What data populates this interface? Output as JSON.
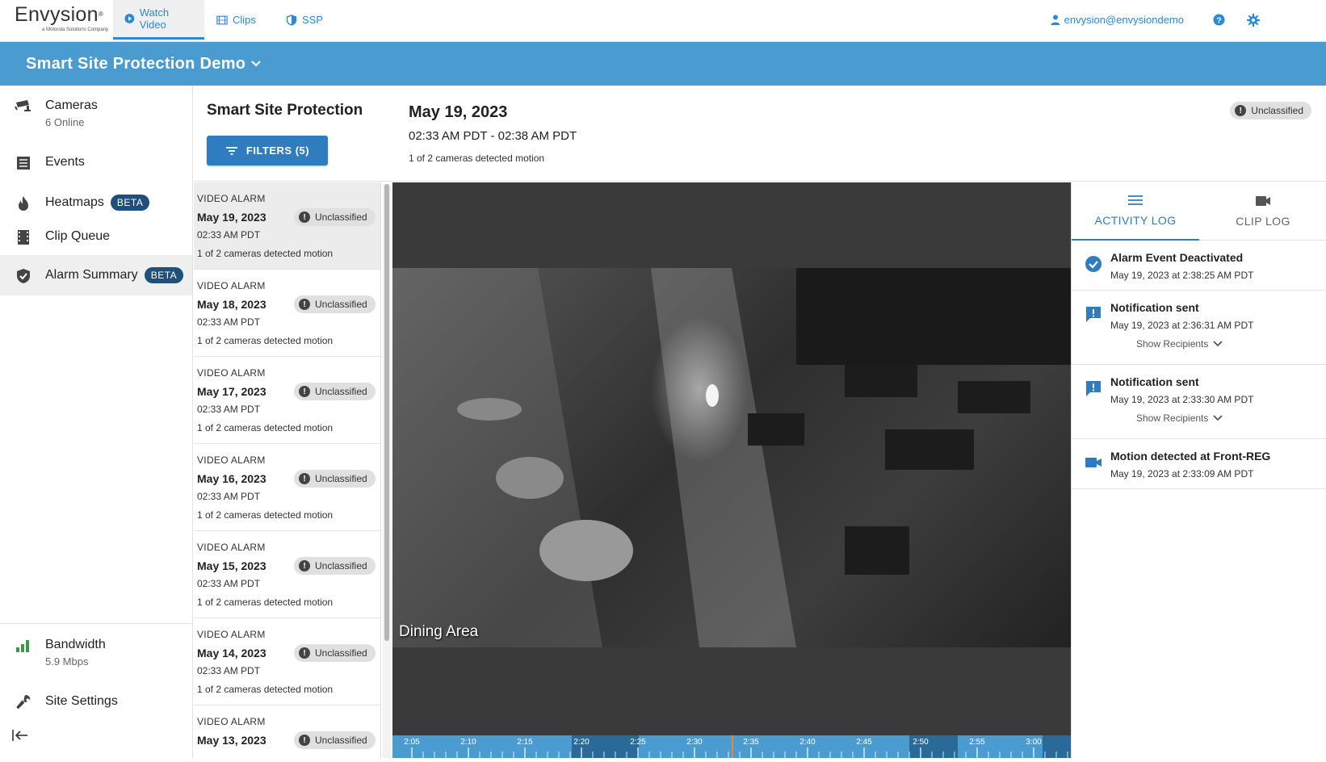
{
  "topnav": {
    "logo_main": "Envysion",
    "logo_sub": "a Motorola Solutions Company",
    "tabs": [
      {
        "label": "Watch Video",
        "icon": "play-circle-icon"
      },
      {
        "label": "Clips",
        "icon": "film-icon"
      },
      {
        "label": "SSP",
        "icon": "shield-icon"
      }
    ],
    "user": "envysion@envysiondemo",
    "accent_color": "#2a8ad4"
  },
  "site": {
    "title": "Smart Site Protection Demo",
    "bar_color": "#4a9cd0"
  },
  "sidebar": {
    "items": [
      {
        "label": "Cameras",
        "sub": "6 Online",
        "icon": "cctv-camera-icon"
      },
      {
        "label": "Events",
        "icon": "list-icon"
      },
      {
        "label": "Heatmaps",
        "badge": "BETA",
        "icon": "flame-icon"
      },
      {
        "label": "Clip Queue",
        "icon": "film-strip-icon"
      },
      {
        "label": "Alarm Summary",
        "badge": "BETA",
        "icon": "shield-check-icon"
      }
    ],
    "bottom": [
      {
        "label": "Bandwidth",
        "sub": "5.9 Mbps",
        "icon": "signal-bars-icon"
      },
      {
        "label": "Site Settings",
        "icon": "wrench-icon"
      }
    ]
  },
  "section": {
    "title": "Smart Site Protection",
    "filters_label": "FILTERS (5)"
  },
  "event": {
    "date": "May 19, 2023",
    "time_range": "02:33 AM PDT - 02:38 AM PDT",
    "motion": "1 of 2 cameras detected motion",
    "status": "Unclassified"
  },
  "alarms": [
    {
      "type": "VIDEO ALARM",
      "date": "May 19, 2023",
      "time": "02:33 AM PDT",
      "motion": "1 of 2 cameras detected motion",
      "status": "Unclassified"
    },
    {
      "type": "VIDEO ALARM",
      "date": "May 18, 2023",
      "time": "02:33 AM PDT",
      "motion": "1 of 2 cameras detected motion",
      "status": "Unclassified"
    },
    {
      "type": "VIDEO ALARM",
      "date": "May 17, 2023",
      "time": "02:33 AM PDT",
      "motion": "1 of 2 cameras detected motion",
      "status": "Unclassified"
    },
    {
      "type": "VIDEO ALARM",
      "date": "May 16, 2023",
      "time": "02:33 AM PDT",
      "motion": "1 of 2 cameras detected motion",
      "status": "Unclassified"
    },
    {
      "type": "VIDEO ALARM",
      "date": "May 15, 2023",
      "time": "02:33 AM PDT",
      "motion": "1 of 2 cameras detected motion",
      "status": "Unclassified"
    },
    {
      "type": "VIDEO ALARM",
      "date": "May 14, 2023",
      "time": "02:33 AM PDT",
      "motion": "1 of 2 cameras detected motion",
      "status": "Unclassified"
    },
    {
      "type": "VIDEO ALARM",
      "date": "May 13, 2023",
      "time": "",
      "motion": "",
      "status": "Unclassified"
    }
  ],
  "video": {
    "camera_label": "Dining Area",
    "timeline_ticks": [
      "2:05",
      "2:10",
      "2:15",
      "2:20",
      "2:25",
      "2:30",
      "2:35",
      "2:40",
      "2:45",
      "2:50",
      "2:55",
      "3:00"
    ]
  },
  "activity": {
    "tabs": [
      {
        "label": "ACTIVITY LOG",
        "icon": "menu-lines-icon"
      },
      {
        "label": "CLIP LOG",
        "icon": "video-camera-icon"
      }
    ],
    "entries": [
      {
        "title": "Alarm Event Deactivated",
        "time": "May 19, 2023 at 2:38:25 AM PDT",
        "icon": "check-circle-icon"
      },
      {
        "title": "Notification sent",
        "time": "May 19, 2023 at 2:36:31 AM PDT",
        "recipients": "Show Recipients",
        "icon": "alert-message-icon"
      },
      {
        "title": "Notification sent",
        "time": "May 19, 2023 at 2:33:30 AM PDT",
        "recipients": "Show Recipients",
        "icon": "alert-message-icon"
      },
      {
        "title": "Motion detected at Front-REG",
        "time": "May 19, 2023 at 2:33:09 AM PDT",
        "icon": "video-camera-icon"
      }
    ]
  }
}
